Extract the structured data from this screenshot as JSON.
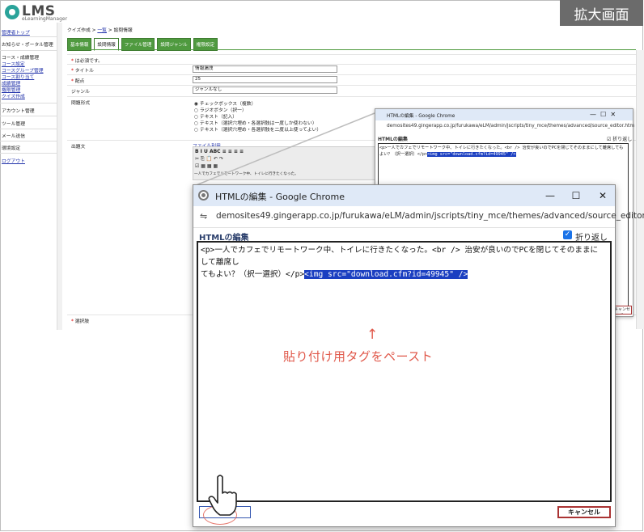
{
  "badge": "拡大画面",
  "logo": {
    "name": "LMS",
    "sub": "eLearningManager"
  },
  "sidebar": {
    "items": [
      {
        "label": "管理者トップ",
        "link": true
      },
      {
        "label": "お知らせ・ポータル管理",
        "link": false
      },
      {
        "label": "コース・成績管理",
        "link": false
      },
      {
        "label": "コース設定",
        "link": true
      },
      {
        "label": "コースグループ管理",
        "link": true
      },
      {
        "label": "コース割り当て",
        "link": true
      },
      {
        "label": "成績管理",
        "link": true
      },
      {
        "label": "権限管理",
        "link": true
      },
      {
        "label": "クイズ作成",
        "link": true
      },
      {
        "label": "アカウント管理",
        "link": false
      },
      {
        "label": "ツール管理",
        "link": false
      },
      {
        "label": "メール送信",
        "link": false
      },
      {
        "label": "環境設定",
        "link": false
      },
      {
        "label": "ログアウト",
        "link": true
      }
    ]
  },
  "breadcrumb": {
    "root": "クイズ作成",
    "sep1": " > ",
    "list": "一覧",
    "sep2": " > ",
    "current": "設問情報"
  },
  "tabs": [
    "基本情報",
    "設問情報",
    "ファイル管理",
    "設問ジャンル",
    "権限設定"
  ],
  "form": {
    "required_note": "は必須です。",
    "title_label": "タイトル",
    "title_value": "情報漏洩",
    "points_label": "配点",
    "points_value": "25",
    "genre_label": "ジャンル",
    "genre_value": "ジャンルなし",
    "format_label": "問題形式",
    "format_options": [
      "チェックボックス（複数）",
      "ラジオボタン（択一）",
      "テキスト（記入）",
      "テキスト（選択穴埋め・各選択肢は一度しか使わない）",
      "テキスト（選択穴埋め・各選択肢を二度以上使ってよい）"
    ],
    "body_label": "出題文",
    "file_link": "ファイル利用",
    "choice_label": "選択肢",
    "editor_preview_1": "一人でカフェでリモートワーク中、トイレに行きたくなった。",
    "editor_preview_2": "安が良いのでPCを閉じてそのままにして離席してもよい？（択一選択）"
  },
  "small_popup": {
    "title": "HTMLの編集 - Google Chrome",
    "url": "demosites49.gingerapp.co.jp/furukawa/eLM/admin/jscripts/tiny_mce/themes/advanced/source_editor.htm",
    "heading": "HTMLの編集",
    "wrap": "折り返し",
    "code_plain": "<p>一人でカフェでリモートワーク中、トイレに行きたくなった。<br />  治安が良いのでPCを閉じてそのままにして離席してもよい？（択一選択）</p>",
    "code_selected": "<img src=\"download.cfm?id=49945\" />",
    "cancel": "キャンセル"
  },
  "popup": {
    "title": "HTMLの編集 - Google Chrome",
    "url": "demosites49.gingerapp.co.jp/furukawa/eLM/admin/jscripts/tiny_mce/themes/advanced/source_editor.htm",
    "heading": "HTMLの編集",
    "wrap_label": "折り返し",
    "wrap_checked": true,
    "code_line1": "<p>一人でカフェでリモートワーク中、トイレに行きたくなった。<br />  治安が良いのでPCを閉じてそのままにして離席し",
    "code_line2_plain": "てもよい？（択一選択）</p>",
    "code_line2_selected": "<img src=\"download.cfm?id=49945\" />",
    "arrow": "↑",
    "annotation": "貼り付け用タグをペースト",
    "update_button": "更新",
    "cancel_button": "キャンセル"
  },
  "colors": {
    "tab_green": "#4f9a3f",
    "accent_red": "#e0584a",
    "selection_blue": "#1b3fc1",
    "titlebar": "#dfe9f7"
  }
}
